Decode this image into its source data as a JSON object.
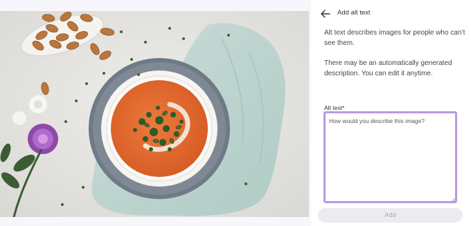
{
  "panel": {
    "back_icon": "arrow-left-icon",
    "title": "Add alt text",
    "description_1": "Alt text describes images for people who can’t see them.",
    "description_2": "There may be an automatically generated description. You can edit it anytime.",
    "alt_label": "Alt text*",
    "alt_value": "",
    "alt_placeholder": "How would you describe this image?",
    "add_button_label": "Add",
    "add_button_state": "disabled"
  },
  "colors": {
    "focus_border": "#b79ae3",
    "soup": "#e0642e",
    "button_bg": "#ecebf0",
    "button_text": "#a9a8b2"
  }
}
